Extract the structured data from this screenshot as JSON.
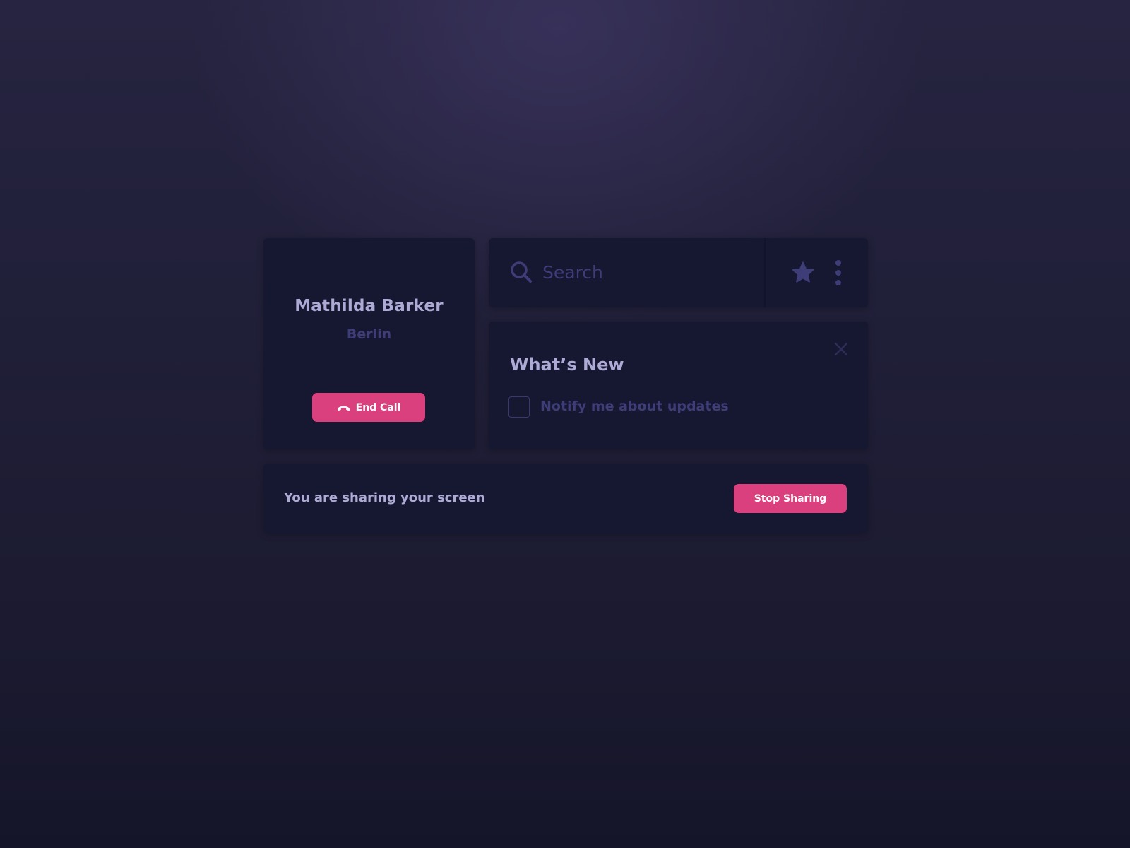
{
  "profile": {
    "name": "Mathilda Barker",
    "city": "Berlin",
    "end_call_label": "End Call"
  },
  "search": {
    "placeholder": "Search",
    "icons": [
      "search-icon",
      "star-icon",
      "more-vertical-icon"
    ]
  },
  "whats_new": {
    "title": "What’s New",
    "checkbox_label": "Notify me about updates",
    "checkbox_checked": false
  },
  "share_bar": {
    "message": "You are sharing your screen",
    "stop_label": "Stop Sharing"
  },
  "colors": {
    "accent": "#da3f7e",
    "card": "#161730",
    "text_primary": "#aeaad6",
    "text_muted": "#3f3d78"
  }
}
